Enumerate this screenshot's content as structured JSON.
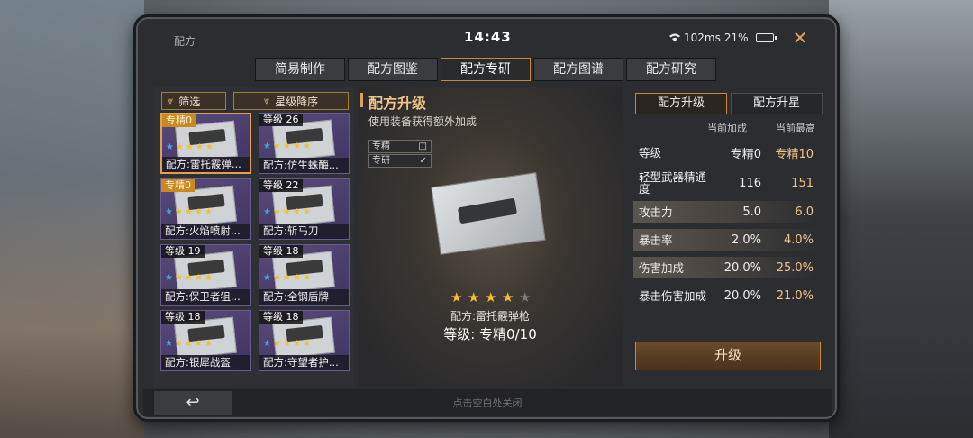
{
  "status": {
    "app_title": "配方",
    "clock": "14:43",
    "ping": "102ms",
    "battery": "21%",
    "battery_level": 0.21
  },
  "tabs": [
    {
      "label": "简易制作",
      "active": false
    },
    {
      "label": "配方图鉴",
      "active": false
    },
    {
      "label": "配方专研",
      "active": true
    },
    {
      "label": "配方图谱",
      "active": false
    },
    {
      "label": "配方研究",
      "active": false
    }
  ],
  "filters": {
    "filter_label": "筛选",
    "sort_label": "星级降序"
  },
  "cards": [
    {
      "badge": "专精0",
      "badge_style": "gold",
      "name": "配方:雷托霰弹...",
      "selected": true
    },
    {
      "badge": "等级 26",
      "badge_style": "dark",
      "name": "配方:仿生蛛酶..."
    },
    {
      "badge": "专精0",
      "badge_style": "gold",
      "name": "配方:火焰喷射..."
    },
    {
      "badge": "等级 22",
      "badge_style": "dark",
      "name": "配方:斩马刀"
    },
    {
      "badge": "等级 19",
      "badge_style": "dark",
      "name": "配方:保卫者狙..."
    },
    {
      "badge": "等级 18",
      "badge_style": "dark",
      "name": "配方:全钢盾牌"
    },
    {
      "badge": "等级 18",
      "badge_style": "dark",
      "name": "配方:银犀战盔"
    },
    {
      "badge": "等级 18",
      "badge_style": "dark",
      "name": "配方:守望者护..."
    }
  ],
  "upgrade": {
    "title": "配方升级",
    "subtitle": "使用装备获得额外加成",
    "options": [
      {
        "label": "专精",
        "mark": "□"
      },
      {
        "label": "专研",
        "mark": "✓"
      }
    ],
    "item_name": "配方:雷托霰弹枪",
    "item_level": "等级:  专精0/10",
    "stars_lit": 4,
    "stars_total": 5
  },
  "right": {
    "tabs": [
      {
        "label": "配方升级",
        "active": true
      },
      {
        "label": "配方升星",
        "active": false
      }
    ],
    "col_current": "当前加成",
    "col_max": "当前最高",
    "stats": [
      {
        "label": "等级",
        "cur": "专精0",
        "max": "专精10",
        "highlight": false
      },
      {
        "label": "轻型武器精通度",
        "cur": "116",
        "max": "151",
        "highlight": false
      },
      {
        "label": "攻击力",
        "cur": "5.0",
        "max": "6.0",
        "highlight": true
      },
      {
        "label": "暴击率",
        "cur": "2.0%",
        "max": "4.0%",
        "highlight": true
      },
      {
        "label": "伤害加成",
        "cur": "20.0%",
        "max": "25.0%",
        "highlight": true
      },
      {
        "label": "暴击伤害加成",
        "cur": "20.0%",
        "max": "21.0%",
        "highlight": false
      }
    ],
    "upgrade_button": "升级"
  },
  "footer": {
    "back_icon": "↩",
    "hint": "点击空白处关闭"
  },
  "icons": {
    "close": "✕",
    "star": "★",
    "chevron": "⩔"
  },
  "colors": {
    "accent": "#c48a3a",
    "gold_text": "#f0c28a",
    "card_bg": "#4b3f6e"
  }
}
